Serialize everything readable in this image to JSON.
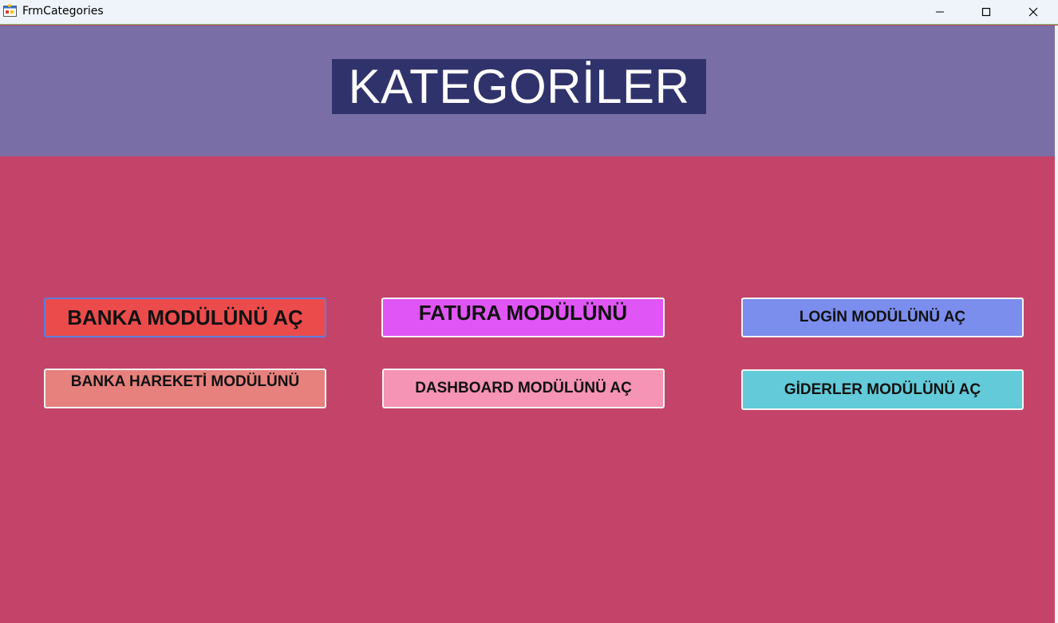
{
  "window": {
    "title": "FrmCategories",
    "controls": {
      "minimize_icon": "minimize-icon",
      "maximize_icon": "maximize-icon",
      "close_icon": "close-icon"
    }
  },
  "header": {
    "title": "KATEGORİLER",
    "background": "#7a6ea6",
    "title_background": "#30336b"
  },
  "body": {
    "background": "#c44469"
  },
  "buttons": {
    "banka": {
      "label": "BANKA MODÜLÜNÜ AÇ",
      "color": "#eb4b4b"
    },
    "fatura": {
      "label": "FATURA MODÜLÜNÜ",
      "color": "#e055f5"
    },
    "login": {
      "label": "LOGİN MODÜLÜNÜ AÇ",
      "color": "#7b8ded"
    },
    "banka_hareketi": {
      "label": "BANKA HAREKETİ MODÜLÜNÜ",
      "color": "#e6817d"
    },
    "dashboard": {
      "label": "DASHBOARD MODÜLÜNÜ AÇ",
      "color": "#f594b4"
    },
    "giderler": {
      "label": "GİDERLER MODÜLÜNÜ AÇ",
      "color": "#62cad8"
    }
  }
}
